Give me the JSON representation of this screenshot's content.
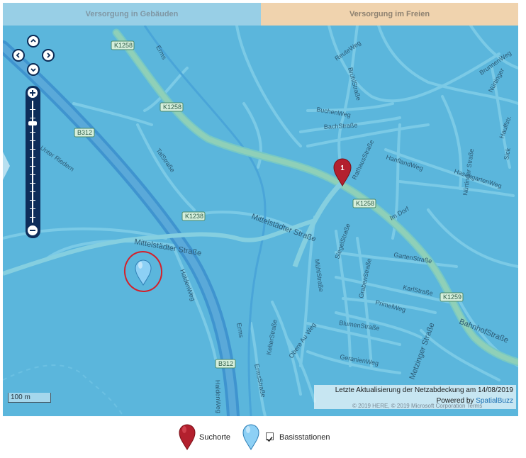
{
  "tabs": [
    {
      "label": "Versorgung in Gebäuden"
    },
    {
      "label": "Versorgung im Freien"
    }
  ],
  "map": {
    "road_labels": [
      "K1258",
      "K1258",
      "K1258",
      "K1238",
      "K1259",
      "B312",
      "B312",
      "Erms",
      "Erms",
      "ReuteWeg",
      "BrühlStraße",
      "BuchenWeg",
      "BachStraße",
      "BrunnenWeg",
      "Nürtinger",
      "Hauffstr.",
      "Sick",
      "RathausStraße",
      "HanflandWeg",
      "Nürtinger Straße",
      "HasengartenWeg",
      "Im Dorf",
      "TalStraße",
      "Mittelstädter Straße",
      "Mittelstädter Straße",
      "Unter Riedern",
      "HaldenWeg",
      "HaldenWeg",
      "SiegelStraße",
      "MühlStraße",
      "GartenStraße",
      "GrabenStraße",
      "KarlStraße",
      "PrimelWeg",
      "BahnhofStraße",
      "BlumenStraße",
      "Obere Au Weg",
      "KelterStraße",
      "ErmsStraße",
      "GeranienWeg",
      "Metzinger Straße"
    ],
    "search_marker_label": "1",
    "scale_label": "100 m",
    "info_line1": "Letzte Aktualisierung der Netzabdeckung am 14/08/2019",
    "info_powered": "Powered by ",
    "info_brand": "SpatialBuzz",
    "copyright": "© 2019 HERE, © 2019 Microsoft Corporation  Terms"
  },
  "legend": {
    "suchorte": "Suchorte",
    "basisstationen": "Basisstationen",
    "basisstationen_checked": true
  },
  "colors": {
    "water_area": "#5bb6dc",
    "road": "#7fcde8",
    "main_road": "#8fd0b8",
    "search_pin": "#b3202e",
    "station_pin": "#8dd0f5",
    "annotation_circle": "#d4202a"
  }
}
